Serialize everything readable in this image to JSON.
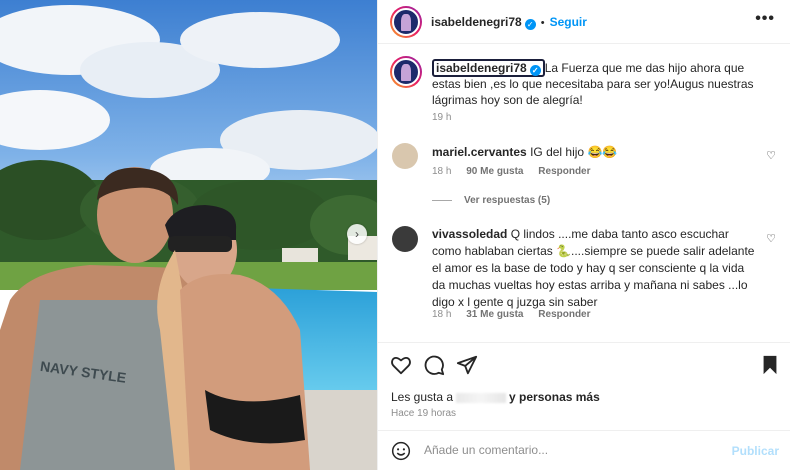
{
  "post": {
    "author": "isabeldenegri78",
    "follow_label": "Seguir",
    "more_label": "•••",
    "caption": "La Fuerza que me das hijo ahora que estas bien ,es lo que necesitaba para ser yo!Augus nuestras lágrimas hoy son de alegría!",
    "caption_time": "19 h"
  },
  "comments": [
    {
      "user": "mariel.cervantes",
      "text": "IG del hijo 😂😂",
      "time": "18 h",
      "likes": "90 Me gusta",
      "reply_label": "Responder",
      "view_replies": "Ver respuestas (5)"
    },
    {
      "user": "vivassoledad",
      "text": "Q lindos ....me daba tanto asco escuchar como hablaban ciertas 🐍....siempre se puede salir adelante el amor es la base de todo y hay q ser consciente q la vida da muchas vueltas hoy estas arriba y mañana ni sabes ...lo digo x l gente q juzga sin saber",
      "time": "18 h",
      "likes": "31 Me gusta",
      "reply_label": "Responder"
    }
  ],
  "engagement": {
    "likes_prefix": "Les gusta a",
    "likes_suffix": "y personas más",
    "time_ago": "Hace 19 horas"
  },
  "composer": {
    "placeholder": "Añade un comentario...",
    "publish_label": "Publicar"
  },
  "icons": {
    "like": "heart-icon",
    "comment": "comment-icon",
    "share": "send-icon",
    "save": "bookmark-icon",
    "emoji": "emoji-icon",
    "verified": "verified-badge-icon",
    "next": "chevron-right-icon"
  },
  "colors": {
    "accent": "#0095f6",
    "publish_disabled": "#b2dffc",
    "muted": "#8e8e8e"
  }
}
